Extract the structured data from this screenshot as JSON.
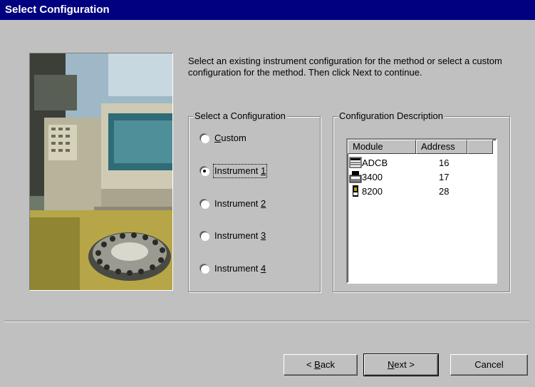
{
  "dialog": {
    "title": "Select Configuration"
  },
  "intro_text": "Select an existing instrument configuration for the method or select a custom configuration for the method. Then click Next to continue.",
  "config_group": {
    "title": "Select a Configuration",
    "options": [
      {
        "pre": "",
        "key": "C",
        "post": "ustom",
        "checked": false
      },
      {
        "pre": "Instrument ",
        "key": "1",
        "post": "",
        "checked": true
      },
      {
        "pre": "Instrument ",
        "key": "2",
        "post": "",
        "checked": false
      },
      {
        "pre": "Instrument ",
        "key": "3",
        "post": "",
        "checked": false
      },
      {
        "pre": "Instrument ",
        "key": "4",
        "post": "",
        "checked": false
      }
    ]
  },
  "description_group": {
    "title": "Configuration Description",
    "columns": [
      "Module",
      "Address"
    ],
    "rows": [
      {
        "module": "ADCB",
        "address": "16",
        "icon": "adcb-module-icon"
      },
      {
        "module": "3400",
        "address": "17",
        "icon": "3400-module-icon"
      },
      {
        "module": "8200",
        "address": "28",
        "icon": "8200-module-icon"
      }
    ]
  },
  "buttons": {
    "back": {
      "pre": "< ",
      "key": "B",
      "post": "ack"
    },
    "next": {
      "pre": "",
      "key": "N",
      "post": "ext >"
    },
    "cancel": "Cancel"
  }
}
